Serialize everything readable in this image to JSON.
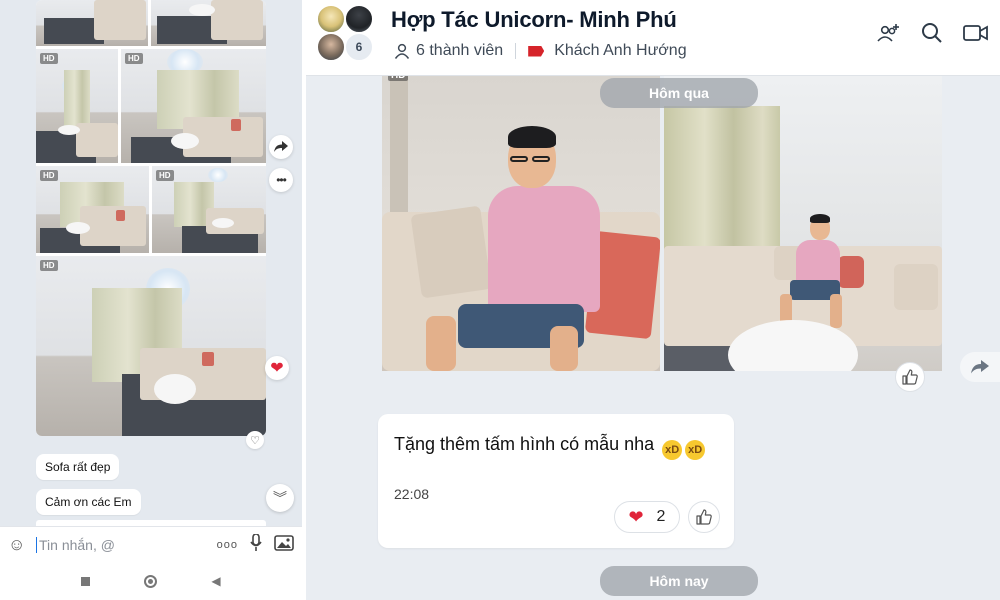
{
  "left_panel": {
    "hd_badge": "HD",
    "messages": [
      "Sofa rất đẹp",
      "Cảm ơn các Em"
    ],
    "composer": {
      "placeholder": "Tin nhắn, @"
    },
    "icons": {
      "forward": "share-arrow-icon",
      "more": "more-dots-icon",
      "reaction": "heart-icon",
      "scroll_down": "chevron-double-down-icon",
      "emoji": "emoji-icon",
      "mic": "mic-icon",
      "image": "image-icon",
      "nav_square": "square-nav-icon",
      "nav_circle": "circle-nav-icon",
      "nav_back": "triangle-back-icon"
    }
  },
  "header": {
    "title": "Hợp Tác Unicorn- Minh Phú",
    "member_count_badge": "6",
    "members_label": "6 thành viên",
    "tag_label": "Khách Anh Hướng",
    "tag_color": "#d6242a",
    "icons": [
      "add-member-icon",
      "search-icon",
      "video-call-icon"
    ]
  },
  "chat": {
    "hd_badge": "HD",
    "date_yesterday": "Hôm qua",
    "date_today": "Hôm nay",
    "message": {
      "text": "Tặng thêm tấm hình có mẫu nha",
      "emojis": [
        "🤣",
        "🤣"
      ],
      "time": "22:08",
      "reaction_count": "2",
      "reaction_emoji": "❤"
    }
  },
  "colors": {
    "accent": "#1b74e4",
    "chat_bg": "#e9edf2",
    "heart": "#e0253a"
  }
}
